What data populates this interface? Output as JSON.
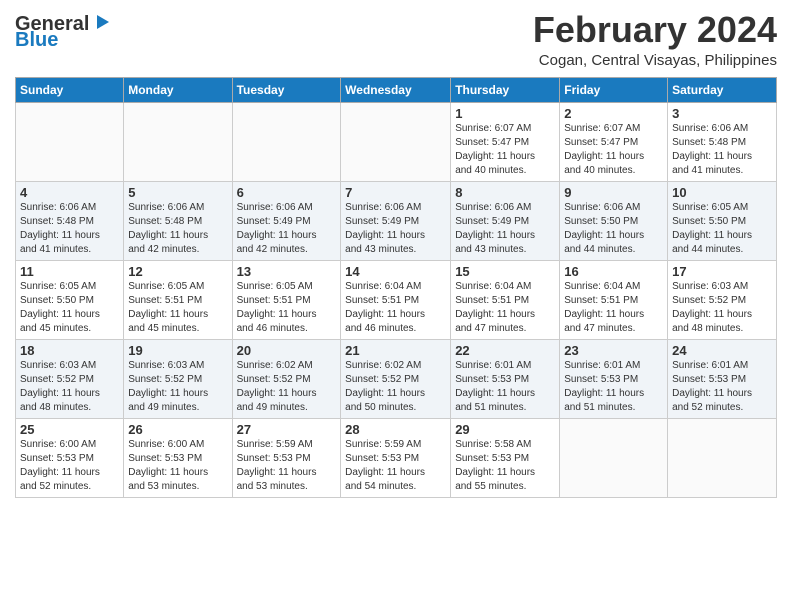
{
  "logo": {
    "general": "General",
    "blue": "Blue"
  },
  "title": {
    "month_year": "February 2024",
    "location": "Cogan, Central Visayas, Philippines"
  },
  "days_of_week": [
    "Sunday",
    "Monday",
    "Tuesday",
    "Wednesday",
    "Thursday",
    "Friday",
    "Saturday"
  ],
  "weeks": [
    [
      {
        "day": "",
        "info": ""
      },
      {
        "day": "",
        "info": ""
      },
      {
        "day": "",
        "info": ""
      },
      {
        "day": "",
        "info": ""
      },
      {
        "day": "1",
        "info": "Sunrise: 6:07 AM\nSunset: 5:47 PM\nDaylight: 11 hours\nand 40 minutes."
      },
      {
        "day": "2",
        "info": "Sunrise: 6:07 AM\nSunset: 5:47 PM\nDaylight: 11 hours\nand 40 minutes."
      },
      {
        "day": "3",
        "info": "Sunrise: 6:06 AM\nSunset: 5:48 PM\nDaylight: 11 hours\nand 41 minutes."
      }
    ],
    [
      {
        "day": "4",
        "info": "Sunrise: 6:06 AM\nSunset: 5:48 PM\nDaylight: 11 hours\nand 41 minutes."
      },
      {
        "day": "5",
        "info": "Sunrise: 6:06 AM\nSunset: 5:48 PM\nDaylight: 11 hours\nand 42 minutes."
      },
      {
        "day": "6",
        "info": "Sunrise: 6:06 AM\nSunset: 5:49 PM\nDaylight: 11 hours\nand 42 minutes."
      },
      {
        "day": "7",
        "info": "Sunrise: 6:06 AM\nSunset: 5:49 PM\nDaylight: 11 hours\nand 43 minutes."
      },
      {
        "day": "8",
        "info": "Sunrise: 6:06 AM\nSunset: 5:49 PM\nDaylight: 11 hours\nand 43 minutes."
      },
      {
        "day": "9",
        "info": "Sunrise: 6:06 AM\nSunset: 5:50 PM\nDaylight: 11 hours\nand 44 minutes."
      },
      {
        "day": "10",
        "info": "Sunrise: 6:05 AM\nSunset: 5:50 PM\nDaylight: 11 hours\nand 44 minutes."
      }
    ],
    [
      {
        "day": "11",
        "info": "Sunrise: 6:05 AM\nSunset: 5:50 PM\nDaylight: 11 hours\nand 45 minutes."
      },
      {
        "day": "12",
        "info": "Sunrise: 6:05 AM\nSunset: 5:51 PM\nDaylight: 11 hours\nand 45 minutes."
      },
      {
        "day": "13",
        "info": "Sunrise: 6:05 AM\nSunset: 5:51 PM\nDaylight: 11 hours\nand 46 minutes."
      },
      {
        "day": "14",
        "info": "Sunrise: 6:04 AM\nSunset: 5:51 PM\nDaylight: 11 hours\nand 46 minutes."
      },
      {
        "day": "15",
        "info": "Sunrise: 6:04 AM\nSunset: 5:51 PM\nDaylight: 11 hours\nand 47 minutes."
      },
      {
        "day": "16",
        "info": "Sunrise: 6:04 AM\nSunset: 5:51 PM\nDaylight: 11 hours\nand 47 minutes."
      },
      {
        "day": "17",
        "info": "Sunrise: 6:03 AM\nSunset: 5:52 PM\nDaylight: 11 hours\nand 48 minutes."
      }
    ],
    [
      {
        "day": "18",
        "info": "Sunrise: 6:03 AM\nSunset: 5:52 PM\nDaylight: 11 hours\nand 48 minutes."
      },
      {
        "day": "19",
        "info": "Sunrise: 6:03 AM\nSunset: 5:52 PM\nDaylight: 11 hours\nand 49 minutes."
      },
      {
        "day": "20",
        "info": "Sunrise: 6:02 AM\nSunset: 5:52 PM\nDaylight: 11 hours\nand 49 minutes."
      },
      {
        "day": "21",
        "info": "Sunrise: 6:02 AM\nSunset: 5:52 PM\nDaylight: 11 hours\nand 50 minutes."
      },
      {
        "day": "22",
        "info": "Sunrise: 6:01 AM\nSunset: 5:53 PM\nDaylight: 11 hours\nand 51 minutes."
      },
      {
        "day": "23",
        "info": "Sunrise: 6:01 AM\nSunset: 5:53 PM\nDaylight: 11 hours\nand 51 minutes."
      },
      {
        "day": "24",
        "info": "Sunrise: 6:01 AM\nSunset: 5:53 PM\nDaylight: 11 hours\nand 52 minutes."
      }
    ],
    [
      {
        "day": "25",
        "info": "Sunrise: 6:00 AM\nSunset: 5:53 PM\nDaylight: 11 hours\nand 52 minutes."
      },
      {
        "day": "26",
        "info": "Sunrise: 6:00 AM\nSunset: 5:53 PM\nDaylight: 11 hours\nand 53 minutes."
      },
      {
        "day": "27",
        "info": "Sunrise: 5:59 AM\nSunset: 5:53 PM\nDaylight: 11 hours\nand 53 minutes."
      },
      {
        "day": "28",
        "info": "Sunrise: 5:59 AM\nSunset: 5:53 PM\nDaylight: 11 hours\nand 54 minutes."
      },
      {
        "day": "29",
        "info": "Sunrise: 5:58 AM\nSunset: 5:53 PM\nDaylight: 11 hours\nand 55 minutes."
      },
      {
        "day": "",
        "info": ""
      },
      {
        "day": "",
        "info": ""
      }
    ]
  ]
}
